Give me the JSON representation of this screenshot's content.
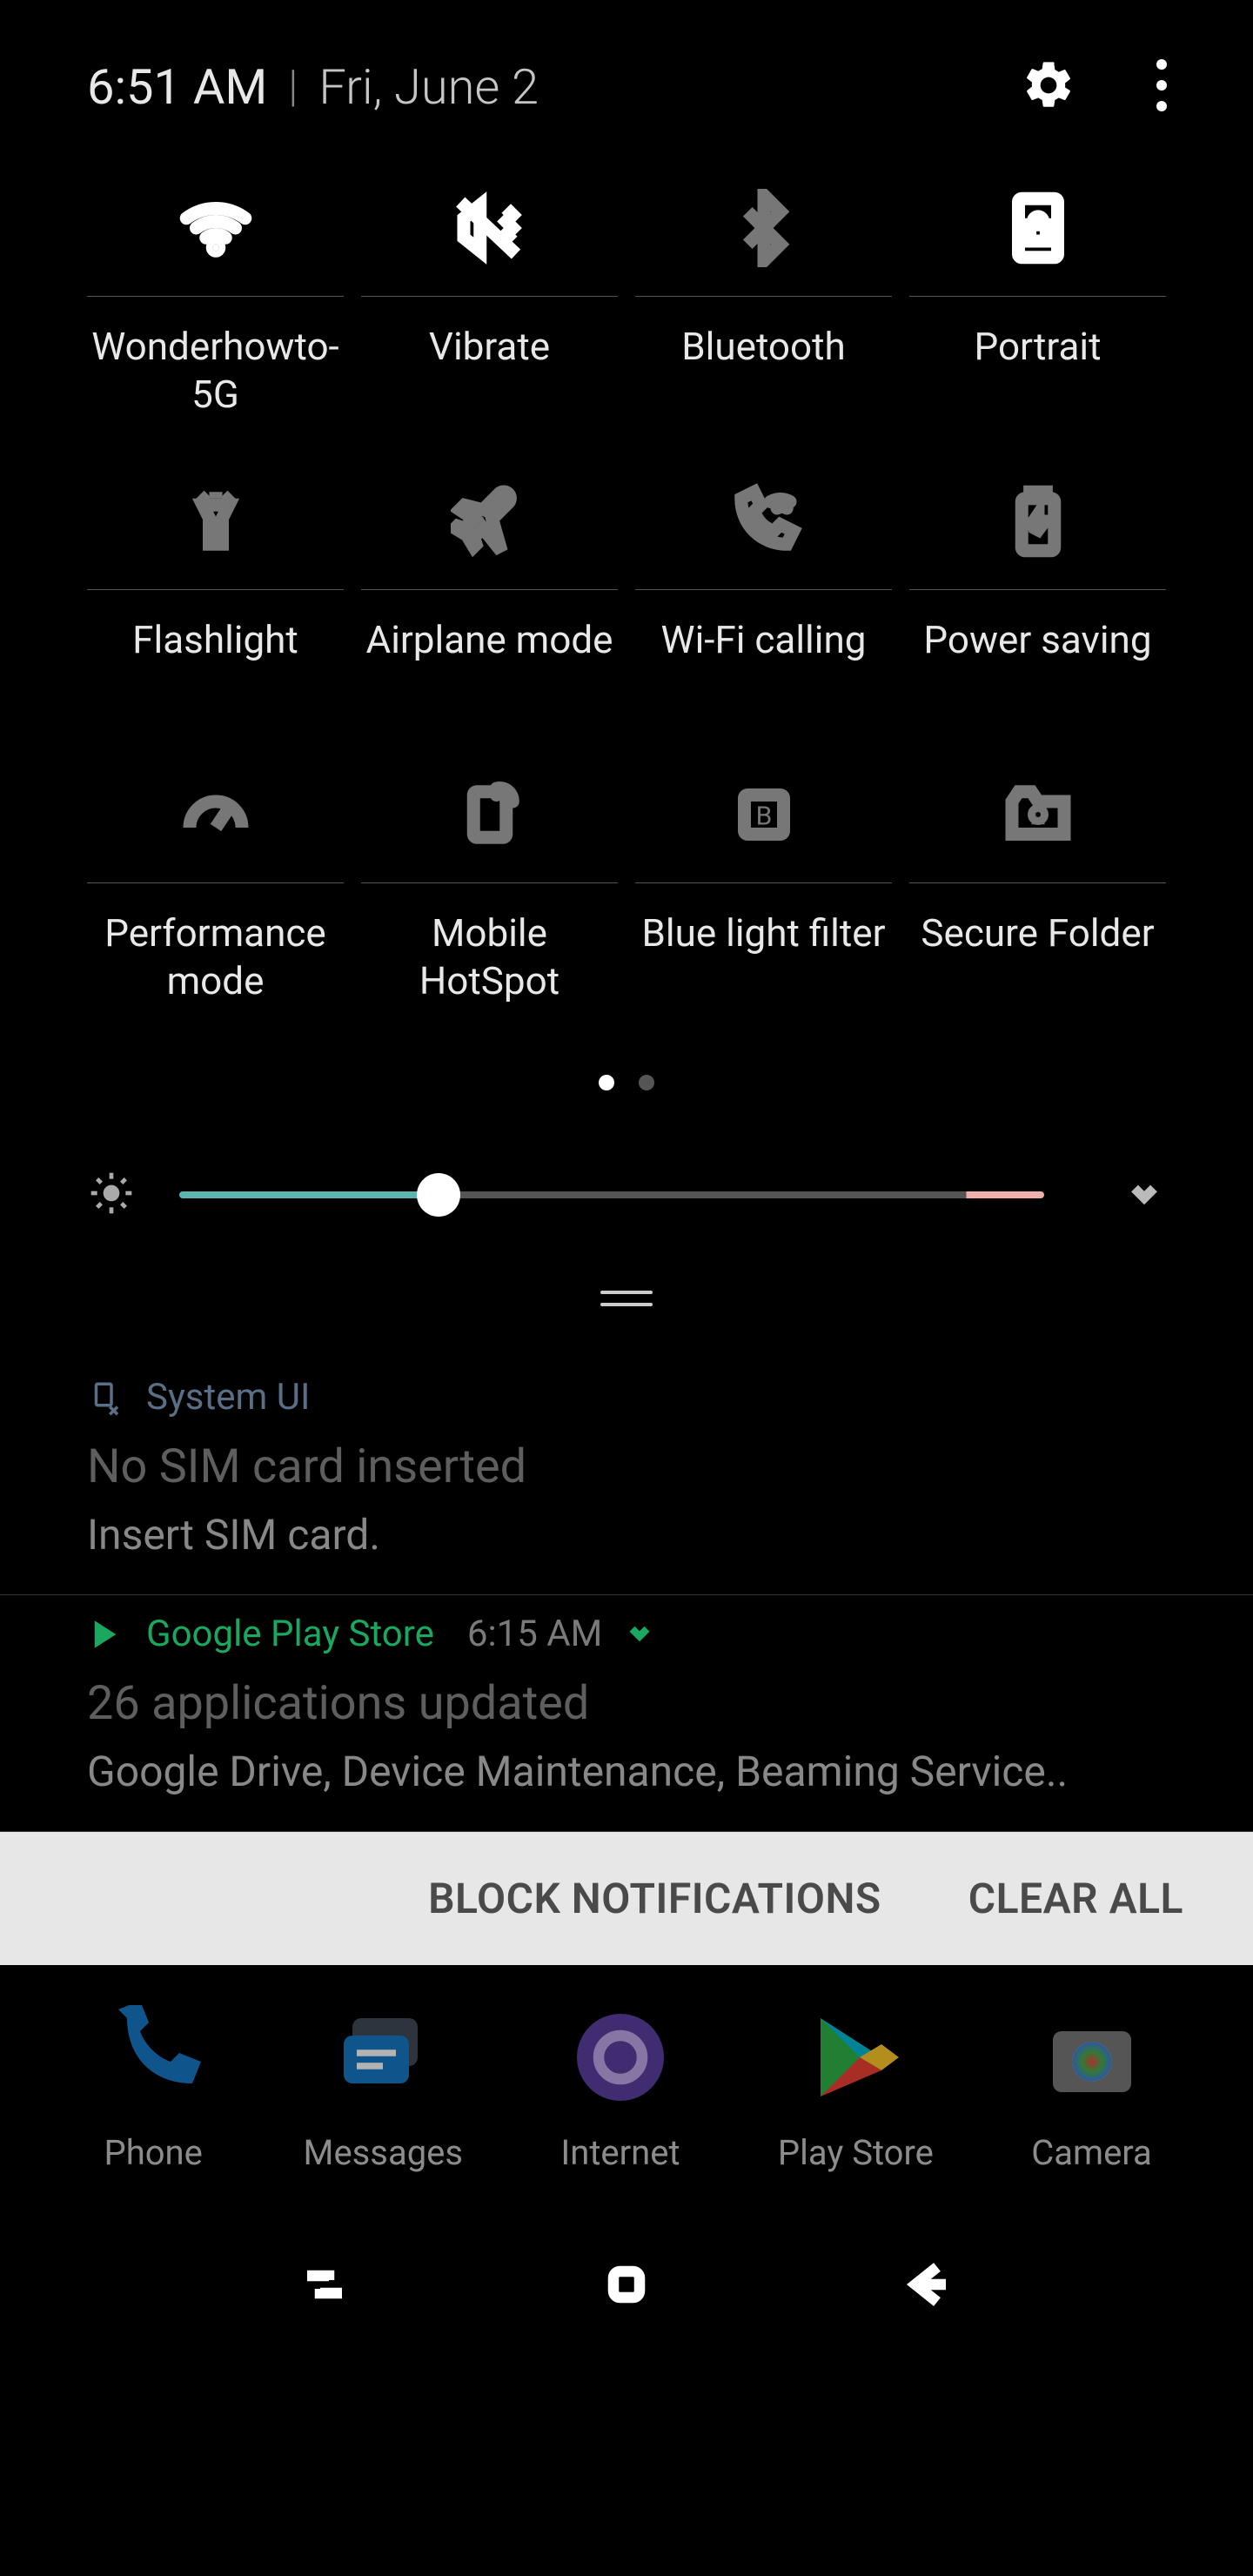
{
  "header": {
    "time": "6:51 AM",
    "date": "Fri, June 2"
  },
  "quick_settings": [
    {
      "label": "Wonderhowto-5G",
      "icon": "wifi-icon",
      "state": "active"
    },
    {
      "label": "Vibrate",
      "icon": "vibrate-icon",
      "state": "active"
    },
    {
      "label": "Bluetooth",
      "icon": "bluetooth-icon",
      "state": "inactive"
    },
    {
      "label": "Portrait",
      "icon": "portrait-lock-icon",
      "state": "active"
    },
    {
      "label": "Flashlight",
      "icon": "flashlight-icon",
      "state": "inactive"
    },
    {
      "label": "Airplane mode",
      "icon": "airplane-icon",
      "state": "inactive"
    },
    {
      "label": "Wi-Fi calling",
      "icon": "wifi-calling-icon",
      "state": "inactive"
    },
    {
      "label": "Power saving",
      "icon": "power-saving-icon",
      "state": "inactive"
    },
    {
      "label": "Performance mode",
      "icon": "performance-icon",
      "state": "inactive"
    },
    {
      "label": "Mobile HotSpot",
      "icon": "hotspot-icon",
      "state": "inactive"
    },
    {
      "label": "Blue light filter",
      "icon": "bluelight-icon",
      "state": "inactive"
    },
    {
      "label": "Secure Folder",
      "icon": "secure-folder-icon",
      "state": "inactive"
    }
  ],
  "pager": {
    "active": 0,
    "count": 2
  },
  "brightness": {
    "percent": 30
  },
  "notifications": [
    {
      "app": "System UI",
      "icon": "sim-missing-icon",
      "time": "",
      "title": "No SIM card inserted",
      "body": "Insert SIM card.",
      "color": "#5a6f85"
    },
    {
      "app": "Google Play Store",
      "icon": "play-store-icon",
      "time": "6:15 AM",
      "title": "26 applications updated",
      "body": "Google Drive, Device Maintenance, Beaming Service..",
      "color": "#1aa760"
    }
  ],
  "actionbar": {
    "block": "BLOCK NOTIFICATIONS",
    "clear": "CLEAR ALL"
  },
  "dock": [
    {
      "label": "Phone",
      "icon": "phone-icon"
    },
    {
      "label": "Messages",
      "icon": "messages-icon"
    },
    {
      "label": "Internet",
      "icon": "internet-icon"
    },
    {
      "label": "Play Store",
      "icon": "play-store-icon"
    },
    {
      "label": "Camera",
      "icon": "camera-icon"
    }
  ]
}
